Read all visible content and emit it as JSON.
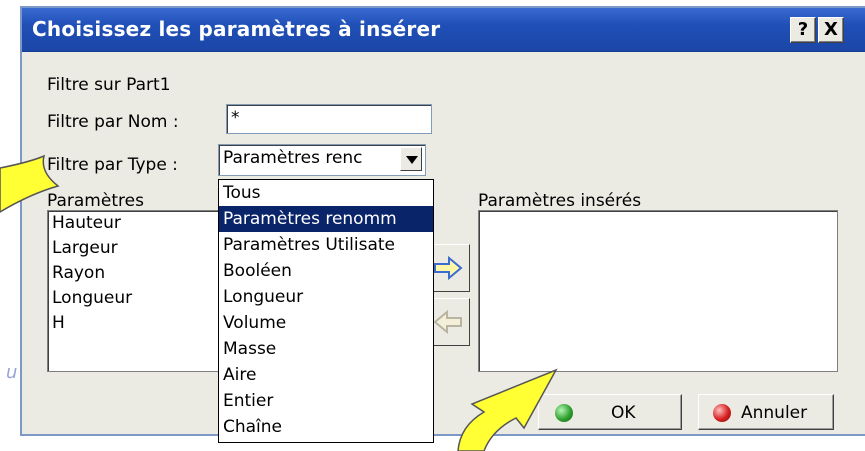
{
  "dialog": {
    "title": "Choisissez les paramètres à insérer",
    "help_button": "?",
    "close_button": "X"
  },
  "filter": {
    "source_label": "Filtre sur Part1",
    "name_label": "Filtre par Nom :",
    "name_value": "*",
    "type_label": "Filtre par Type :",
    "type_value": "Paramètres renc"
  },
  "parameters": {
    "label": "Paramètres",
    "items": [
      "Hauteur",
      "Largeur",
      "Rayon",
      "Longueur",
      "H"
    ]
  },
  "inserted": {
    "label": "Paramètres insérés",
    "items": []
  },
  "type_dropdown": {
    "options": [
      "Tous",
      "Paramètres renomm",
      "Paramètres Utilisate",
      "Booléen",
      "Longueur",
      "Volume",
      "Masse",
      "Aire",
      "Entier",
      "Chaîne"
    ],
    "selected_index": 1
  },
  "buttons": {
    "ok": "OK",
    "cancel": "Annuler"
  },
  "background_fragment": "u",
  "colors": {
    "titlebar": "#1f4fb7",
    "selection": "#0a246a",
    "callout_fill": "#ffff33",
    "ok_ball": "#2fa12f",
    "cancel_ball": "#d62020"
  },
  "icons": {
    "add": "arrow-right-icon",
    "remove": "arrow-left-icon"
  }
}
